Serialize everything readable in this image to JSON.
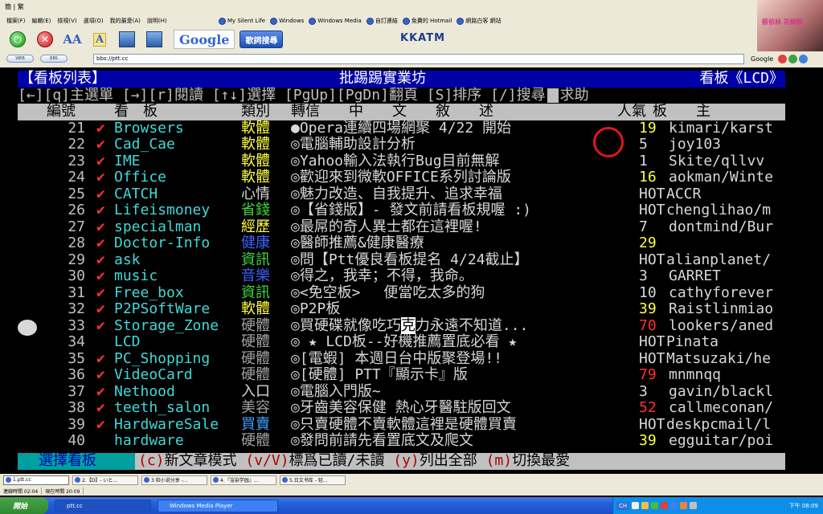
{
  "window": {
    "title": "簡 | 繁"
  },
  "menu": [
    "檔案(F)",
    "編輯(E)",
    "檢視(V)",
    "選項(O)",
    "我的最愛(A)",
    "說明(H)"
  ],
  "links": [
    "My Silent Life",
    "Windows",
    "Windows Media",
    "自訂連結",
    "免費的 Hotmail",
    "網路白客 網站"
  ],
  "toolbar": {
    "google_label": "Google",
    "lyrics_label": "歌詞搜尋",
    "kkatm_label": "KKATM",
    "avatar_ad": "蔡依林 花蝴蝶"
  },
  "address": {
    "url": "bbs://ptt.cc",
    "search_label": "Google",
    "pill1": "WEB",
    "pill2": "BBS"
  },
  "bbs": {
    "header": {
      "left": "【看板列表】",
      "center": "批踢踢實業坊",
      "right": "看板《LCD》"
    },
    "help": "[←][q]主選單 [→][r]閱讀 [↑↓]選擇 [PgUp][PgDn]翻頁 [S]排序 [/]搜尋",
    "help_tail": "求助",
    "columns": {
      "num": "編號",
      "board": "看　板",
      "cls": "類別",
      "trans": "轉信",
      "title": "中　　文　　敘　　述",
      "pop": "人氣",
      "mod": "板　　主"
    },
    "rows": [
      {
        "num": "21",
        "mark": "✔",
        "name": "Browsers",
        "cls": "軟體",
        "cls_color": "#ffff40",
        "title": "●Opera連續四場網聚 4/22 開始",
        "pop": "19",
        "pop_color": "#ffff40",
        "mod": "kimari/karst"
      },
      {
        "num": "22",
        "mark": "✔",
        "name": "Cad_Cae",
        "cls": "軟體",
        "cls_color": "#ffff40",
        "title": "◎電腦輔助設計分析",
        "pop": "5",
        "pop_color": "#d8d8d8",
        "mod": "joy103"
      },
      {
        "num": "23",
        "mark": "✔",
        "name": "IME",
        "cls": "軟體",
        "cls_color": "#ffff40",
        "title": "◎Yahoo輸入法執行Bug目前無解",
        "pop": "1",
        "pop_color": "#d8d8d8",
        "mod": "Skite/qllvv"
      },
      {
        "num": "24",
        "mark": "✔",
        "name": "Office",
        "cls": "軟體",
        "cls_color": "#ffff40",
        "title": "◎歡迎來到微軟OFFICE系列討論版",
        "pop": "16",
        "pop_color": "#ffff40",
        "mod": "aokman/Winte"
      },
      {
        "num": "25",
        "mark": "✔",
        "name": "CATCH",
        "cls": "心情",
        "cls_color": "#d8d8d8",
        "title": "◎魅力改造、自我提升、追求幸福",
        "pop": "HOT",
        "pop_color": "#d8d8d8",
        "mod": "ACCR"
      },
      {
        "num": "26",
        "mark": "✔",
        "name": "Lifeismoney",
        "cls": "省錢",
        "cls_color": "#40d840",
        "title": "◎【省錢版】- 發文前請看板規喔 :)",
        "pop": "HOT",
        "pop_color": "#d8d8d8",
        "mod": "chenglihao/m"
      },
      {
        "num": "27",
        "mark": "✔",
        "name": "specialman",
        "cls": "經歷",
        "cls_color": "#ffff40",
        "title": "◎最屌的奇人異士都在這裡喔!",
        "pop": "7",
        "pop_color": "#d8d8d8",
        "mod": "dontmind/Bur"
      },
      {
        "num": "28",
        "mark": "✔",
        "name": "Doctor-Info",
        "cls": "健康",
        "cls_color": "#4060ff",
        "title": "◎醫師推薦&健康醫療",
        "pop": "29",
        "pop_color": "#ffff40",
        "mod": ""
      },
      {
        "num": "29",
        "mark": "✔",
        "name": "ask",
        "cls": "資訊",
        "cls_color": "#40d840",
        "title": "◎問【Ptt優良看板提名 4/24截止】",
        "pop": "HOT",
        "pop_color": "#d8d8d8",
        "mod": "alianplanet/"
      },
      {
        "num": "30",
        "mark": "✔",
        "name": "music",
        "cls": "音樂",
        "cls_color": "#4060ff",
        "title": "◎得之，我幸；不得，我命。",
        "pop": "3",
        "pop_color": "#d8d8d8",
        "mod": "GARRET"
      },
      {
        "num": "31",
        "mark": "✔",
        "name": "Free_box",
        "cls": "資訊",
        "cls_color": "#40d840",
        "title": "◎<免空板>　 便當吃太多的狗",
        "pop": "10",
        "pop_color": "#d8d8d8",
        "mod": "cathyforever"
      },
      {
        "num": "32",
        "mark": "✔",
        "name": "P2PSoftWare",
        "cls": "軟體",
        "cls_color": "#ffff40",
        "title": "◎P2P板",
        "pop": "39",
        "pop_color": "#ffff40",
        "mod": "Raistlinmiao"
      },
      {
        "num": "33",
        "mark": "✔",
        "name": "Storage_Zone",
        "cls": "硬體",
        "cls_color": "#a0a0a0",
        "title_pre": "◎買硬碟就像吃巧",
        "title_hl": "克",
        "title_post": "力永遠不知道...",
        "pop": "70",
        "pop_color": "#ff3030",
        "mod": "lookers/aned"
      },
      {
        "num": "34",
        "mark": "",
        "name": "LCD",
        "cls": "硬體",
        "cls_color": "#a0a0a0",
        "title": "◎ ★ LCD板--好機推薦置底必看 ★",
        "pop": "HOT",
        "pop_color": "#d8d8d8",
        "mod": "Pinata"
      },
      {
        "num": "35",
        "mark": "✔",
        "name": "PC_Shopping",
        "cls": "硬體",
        "cls_color": "#a0a0a0",
        "title": "◎[電蝦] 本週日台中版聚登場!!",
        "pop": "HOT",
        "pop_color": "#d8d8d8",
        "mod": "Matsuzaki/he"
      },
      {
        "num": "36",
        "mark": "✔",
        "name": "VideoCard",
        "cls": "硬體",
        "cls_color": "#a0a0a0",
        "title": "◎[硬體] PTT『顯示卡』版",
        "pop": "79",
        "pop_color": "#ff3030",
        "mod": "mnmnqq"
      },
      {
        "num": "37",
        "mark": "✔",
        "name": "Nethood",
        "cls": "入口",
        "cls_color": "#d8d8d8",
        "title": "◎電腦入門版~",
        "pop": "3",
        "pop_color": "#d8d8d8",
        "mod": "gavin/blackl"
      },
      {
        "num": "38",
        "mark": "✔",
        "name": "teeth_salon",
        "cls": "美容",
        "cls_color": "#a0a0a0",
        "title": "◎牙齒美容保健 熱心牙醫駐版回文",
        "pop": "52",
        "pop_color": "#ff3030",
        "mod": "callmeconan/"
      },
      {
        "num": "39",
        "mark": "✔",
        "name": "HardwareSale",
        "cls": "買賣",
        "cls_color": "#40a0ff",
        "title": "◎只賣硬體不賣軟體這裡是硬體買賣",
        "pop": "HOT",
        "pop_color": "#d8d8d8",
        "mod": "deskpcmail/l"
      },
      {
        "num": "40",
        "mark": "",
        "name": "hardware",
        "cls": "硬體",
        "cls_color": "#a0a0a0",
        "title": "◎發問前請先看置底文及爬文",
        "pop": "39",
        "pop_color": "#ffff40",
        "mod": "egguitar/poi"
      }
    ],
    "bottom": {
      "select": "選擇看板",
      "items": [
        {
          "key": "(c)",
          "label": "新文章模式 "
        },
        {
          "key": "(v/V)",
          "label": "標爲已讀/未讀 "
        },
        {
          "key": "(y)",
          "label": "列出全部 "
        },
        {
          "key": "(m)",
          "label": "切換最愛"
        }
      ]
    }
  },
  "tabs": [
    "1.ptt.cc",
    "2.【D】- いと...",
    "3.较小说分享 -...",
    "4.『渲染学园』...",
    "5.日文书库 - 轻..."
  ],
  "status": {
    "connect_time": "連線時間 02:04",
    "now_time": "現在時間 20:09"
  },
  "taskbar": {
    "start": "開始",
    "item1": "ptt.cc",
    "item2": "Windows Media Player",
    "lang": "CH",
    "clock": "下午 08:09"
  }
}
